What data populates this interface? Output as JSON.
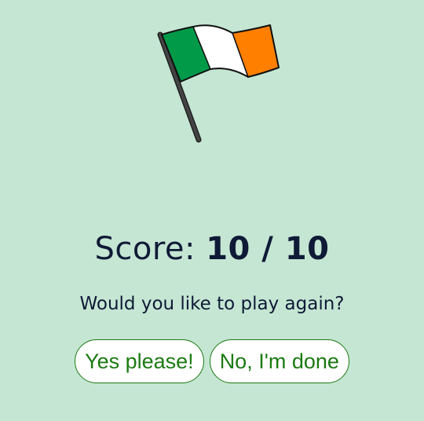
{
  "icon": "irish-flag-icon",
  "colors": {
    "background": "#c5e6d3",
    "flag_green": "#009a49",
    "flag_white": "#ffffff",
    "flag_orange": "#ff7f00",
    "text": "#0f1a36",
    "button_text": "#1b7a12"
  },
  "score": {
    "label": "Score:",
    "value": "10 / 10"
  },
  "question": "Would you like to play again?",
  "buttons": {
    "yes_label": "Yes please!",
    "no_label": "No, I'm done"
  }
}
